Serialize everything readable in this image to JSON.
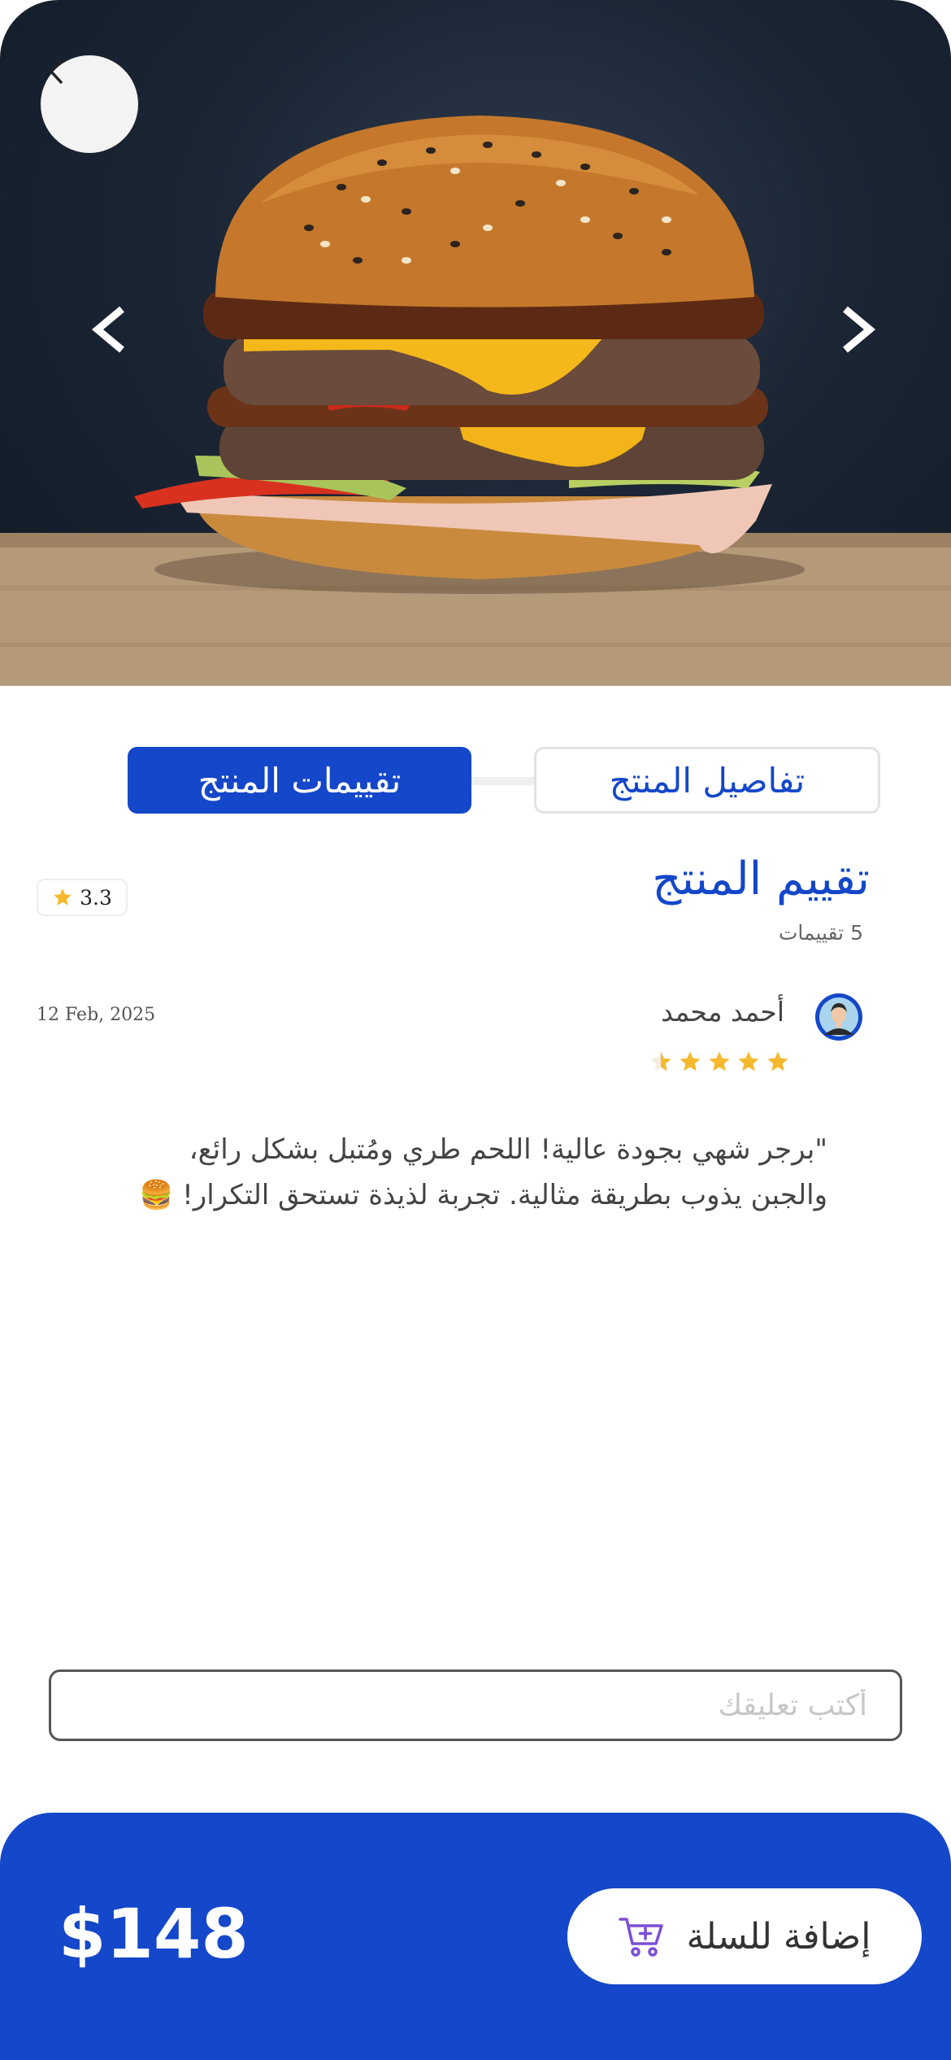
{
  "hero": {
    "back_icon": "chevron-left-icon",
    "prev_icon": "chevron-left-icon",
    "next_icon": "chevron-right-icon"
  },
  "tabs": [
    {
      "label": "تقييمات المنتج",
      "active": true
    },
    {
      "label": "تفاصيل المنتج",
      "active": false
    }
  ],
  "rating": {
    "title": "تقييم المنتج",
    "count_text": "5 تقييمات",
    "average": "3.3"
  },
  "review": {
    "name": "أحمد محمد",
    "date": "12 Feb, 2025",
    "stars": 5,
    "text_line1": "\"برجر شهي بجودة عالية! اللحم طري ومُتبل بشكل رائع،",
    "text_line2": "والجبن يذوب بطريقة مثالية. تجربة لذيذة تستحق التكرار! 🍔"
  },
  "comment": {
    "placeholder": "أكتب تعليقك",
    "value": ""
  },
  "bottom": {
    "price": "$148",
    "cart_label": "إضافة للسلة",
    "cart_icon": "cart-add-icon"
  },
  "colors": {
    "primary": "#1447c9",
    "star": "#f5b92e"
  }
}
